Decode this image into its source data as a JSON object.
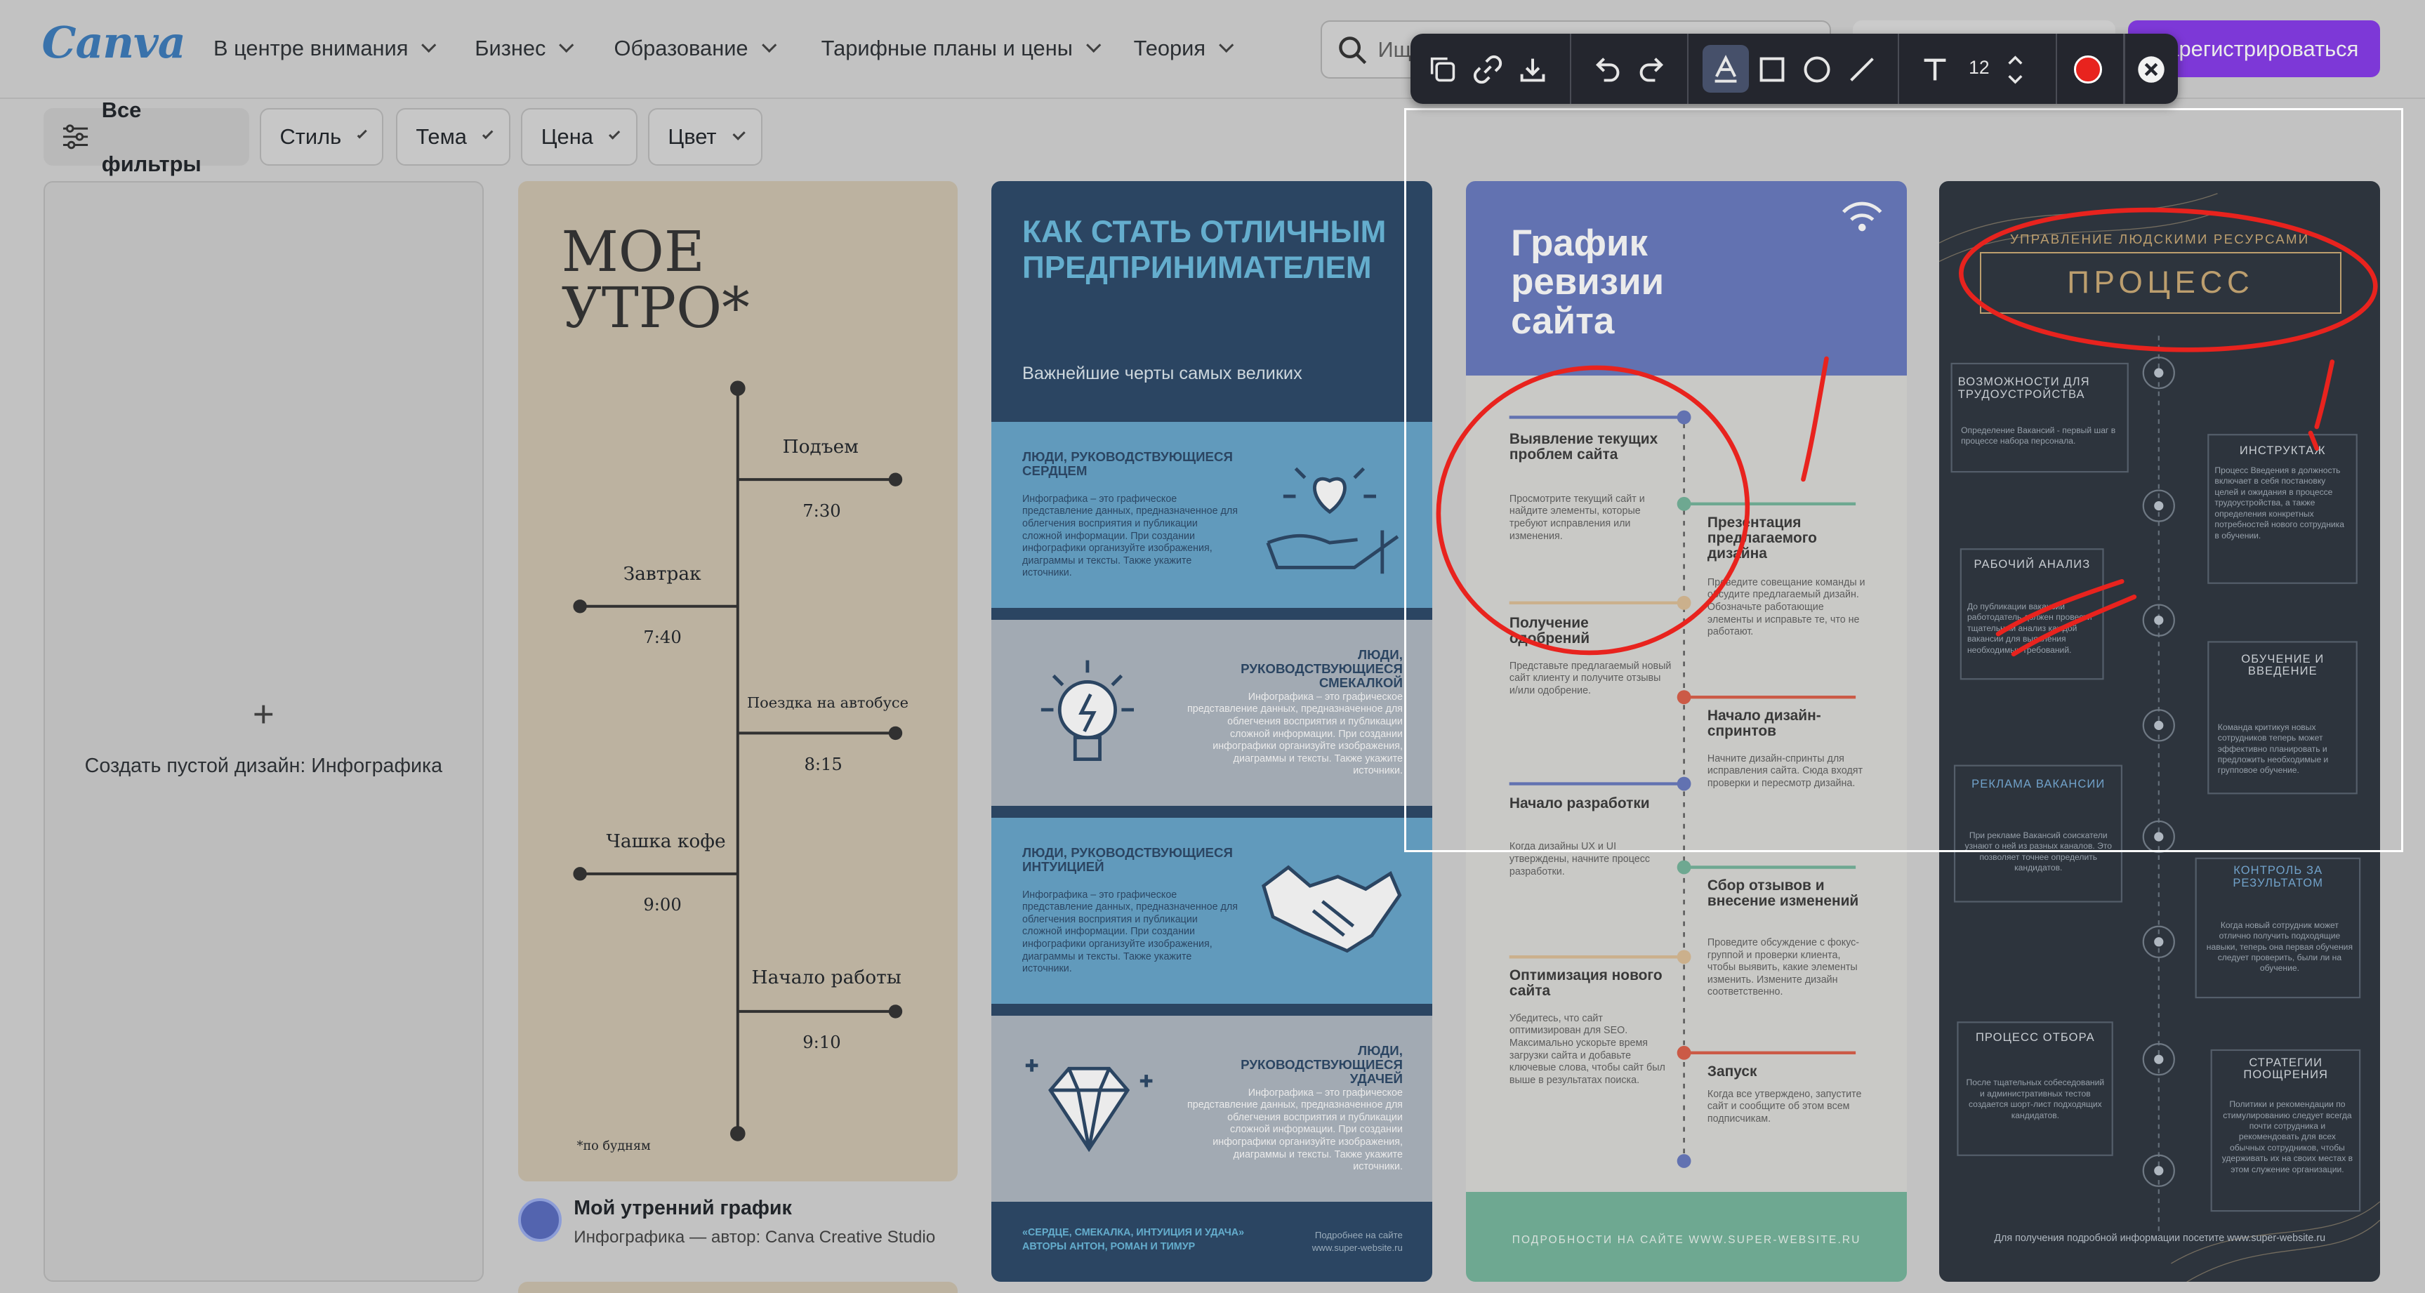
{
  "header": {
    "logo": "Canva",
    "nav": [
      {
        "label": "В центре внимания"
      },
      {
        "label": "Бизнес"
      },
      {
        "label": "Образование"
      },
      {
        "label": "Тарифные планы и цены"
      },
      {
        "label": "Теория"
      }
    ],
    "search_placeholder": "Ищ",
    "register_label": "Зарегистрироваться"
  },
  "filters": {
    "all_label": "Все фильтры",
    "items": [
      {
        "label": "Стиль"
      },
      {
        "label": "Тема"
      },
      {
        "label": "Цена"
      },
      {
        "label": "Цвет"
      }
    ]
  },
  "toolbar": {
    "font_size": "12",
    "active_color": "#e8231e"
  },
  "create_blank": {
    "label": "Создать пустой дизайн: Инфографика"
  },
  "card_morning": {
    "title_line1": "МОЕ",
    "title_line2": "УТРО*",
    "items": [
      {
        "label": "Подъем",
        "time": "7:30"
      },
      {
        "label": "Завтрак",
        "time": "7:40"
      },
      {
        "label": "Поездка на автобусе",
        "time": "8:15"
      },
      {
        "label": "Чашка кофе",
        "time": "9:00"
      },
      {
        "label": "Начало работы",
        "time": "9:10"
      }
    ],
    "footnote": "*по будням",
    "caption_title": "Мой утренний график",
    "caption_sub": "Инфографика — автор: Canva Creative Studio"
  },
  "card_entrepreneur": {
    "title": "КАК СТАТЬ ОТЛИЧНЫМ ПРЕДПРИНИМАТЕЛЕМ",
    "subtitle": "Важнейшие черты самых великих",
    "sections": [
      {
        "heading": "ЛЮДИ, РУКОВОДСТВУЮЩИЕСЯ СЕРДЦЕМ",
        "text": "Инфографика – это графическое представление данных, предназначенное для облегчения восприятия и публикации сложной информации. При создании инфографики организуйте изображения, диаграммы и тексты. Также укажите источники."
      },
      {
        "heading": "ЛЮДИ, РУКОВОДСТВУЮЩИЕСЯ СМЕКАЛКОЙ",
        "text": "Инфографика – это графическое представление данных, предназначенное для облегчения восприятия и публикации сложной информации. При создании инфографики организуйте изображения, диаграммы и тексты. Также укажите источники."
      },
      {
        "heading": "ЛЮДИ, РУКОВОДСТВУЮЩИЕСЯ ИНТУИЦИЕЙ",
        "text": "Инфографика – это графическое представление данных, предназначенное для облегчения восприятия и публикации сложной информации. При создании инфографики организуйте изображения, диаграммы и тексты. Также укажите источники."
      },
      {
        "heading": "ЛЮДИ, РУКОВОДСТВУЮЩИЕСЯ УДАЧЕЙ",
        "text": "Инфографика – это графическое представление данных, предназначенное для облегчения восприятия и публикации сложной информации. При создании инфографики организуйте изображения, диаграммы и тексты. Также укажите источники."
      }
    ],
    "footer_left": "«СЕРДЦЕ, СМЕКАЛКА, ИНТУИЦИЯ И УДАЧА» АВТОРЫ АНТОН, РОМАН И ТИМУР",
    "footer_right": "Подробнее на сайте www.super-website.ru"
  },
  "card_audit": {
    "title": "График ревизии сайта",
    "steps": [
      {
        "heading": "Выявление текущих проблем сайта",
        "text": "Просмотрите текущий сайт и найдите элементы, которые требуют исправления или изменения."
      },
      {
        "heading": "Презентация предлагаемого дизайна",
        "text": "Проведите совещание команды и обсудите предлагаемый дизайн. Обозначьте работающие элементы и исправьте те, что не работают."
      },
      {
        "heading": "Получение одобрений",
        "text": "Представьте предлагаемый новый сайт клиенту и получите отзывы и/или одобрение."
      },
      {
        "heading": "Начало дизайн-спринтов",
        "text": "Начните дизайн-спринты для исправления сайта. Сюда входят проверки и пересмотр дизайна."
      },
      {
        "heading": "Начало разработки",
        "text": "Когда дизайны UX и UI утверждены, начните процесс разработки."
      },
      {
        "heading": "Сбор отзывов и внесение изменений",
        "text": "Проведите обсуждение с фокус-группой и проверки клиента, чтобы выявить, какие элементы изменить. Измените дизайн соответственно."
      },
      {
        "heading": "Оптимизация нового сайта",
        "text": "Убедитесь, что сайт оптимизирован для SEO. Максимально ускорьте время загрузки сайта и добавьте ключевые слова, чтобы сайт был выше в результатах поиска."
      },
      {
        "heading": "Запуск",
        "text": "Когда все утверждено, запустите сайт и сообщите об этом всем подписчикам."
      }
    ],
    "footer": "ПОДРОБНОСТИ НА САЙТЕ WWW.SUPER-WEBSITE.RU"
  },
  "card_hr": {
    "kicker": "УПРАВЛЕНИЕ ЛЮДСКИМИ РЕСУРСАМИ",
    "title": "ПРОЦЕСС",
    "left": [
      {
        "heading": "ВОЗМОЖНОСТИ ДЛЯ ТРУДОУСТРОЙСТВА",
        "text": "Определение Вакансий - первый шаг в процессе набора персонала."
      },
      {
        "heading": "РАБОЧИЙ АНАЛИЗ",
        "text": "До публикации вакансии работодатель должен провести тщательный анализ каждой вакансии для выявления необходимых требований."
      },
      {
        "heading": "РЕКЛАМА ВАКАНСИИ",
        "text": "При рекламе Вакансий соискатели узнают о ней из разных каналов. Это позволяет точнее определить кандидатов."
      },
      {
        "heading": "ПРОЦЕСС ОТБОРА",
        "text": "После тщательных собеседований и административных тестов создается шорт-лист подходящих кандидатов."
      }
    ],
    "right": [
      {
        "heading": "ИНСТРУКТАЖ",
        "text": "Процесс Введения в должность включает в себя постановку целей и ожидания в процессе трудоустройства, а также определения конкретных потребностей нового сотрудника в обучении."
      },
      {
        "heading": "ОБУЧЕНИЕ И ВВЕДЕНИЕ",
        "text": "Команда критикуя новых сотрудников теперь может эффективно планировать и предложить необходимые и групповое обучение."
      },
      {
        "heading": "КОНТРОЛЬ ЗА РЕЗУЛЬТАТОМ",
        "text": "Когда новый сотрудник может отлично получить подходящие навыки, теперь она первая обучения следует проверить, были ли на обучение."
      },
      {
        "heading": "СТРАТЕГИИ ПООЩРЕНИЯ",
        "text": "Политики и рекомендации по стимулированию следует всегда почти сотрудника и рекомендовать для всех обычных сотрудников, чтобы удерживать их на своих местах в этом служение организации."
      }
    ],
    "footer": "Для получения подробной информации посетите www.super-website.ru"
  }
}
